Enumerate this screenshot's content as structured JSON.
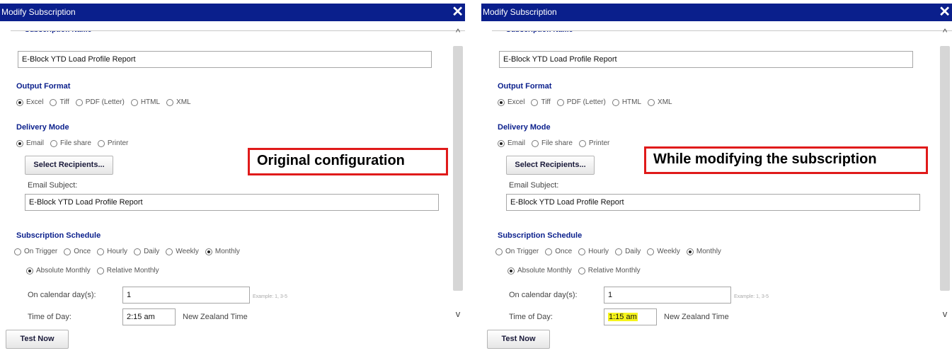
{
  "dialogs": [
    {
      "title": "Modify Subscription",
      "close_icon": "close-icon",
      "clipped_label": "Subscription Name",
      "subscription_name": "E-Block YTD Load Profile Report",
      "output_format": {
        "heading": "Output Format",
        "options": [
          "Excel",
          "Tiff",
          "PDF (Letter)",
          "HTML",
          "XML"
        ],
        "selected": "Excel"
      },
      "delivery_mode": {
        "heading": "Delivery Mode",
        "options": [
          "Email",
          "File share",
          "Printer"
        ],
        "selected": "Email",
        "select_recipients_label": "Select Recipients...",
        "email_subject_label": "Email Subject:",
        "email_subject": "E-Block YTD Load Profile Report"
      },
      "schedule": {
        "heading": "Subscription Schedule",
        "options": [
          "On Trigger",
          "Once",
          "Hourly",
          "Daily",
          "Weekly",
          "Monthly"
        ],
        "selected": "Monthly",
        "monthly_options": [
          "Absolute Monthly",
          "Relative Monthly"
        ],
        "monthly_selected": "Absolute Monthly",
        "calendar_days_label": "On calendar day(s):",
        "calendar_days": "1",
        "calendar_example": "Example: 1, 3-5",
        "time_label": "Time of Day:",
        "time_value": "2:15 am",
        "time_highlighted": false,
        "timezone": "New Zealand Time"
      },
      "test_now_label": "Test Now",
      "callout": "Original configuration"
    },
    {
      "title": "Modify Subscription",
      "close_icon": "close-icon",
      "clipped_label": "Subscription Name",
      "subscription_name": "E-Block YTD Load Profile Report",
      "output_format": {
        "heading": "Output Format",
        "options": [
          "Excel",
          "Tiff",
          "PDF (Letter)",
          "HTML",
          "XML"
        ],
        "selected": "Excel"
      },
      "delivery_mode": {
        "heading": "Delivery Mode",
        "options": [
          "Email",
          "File share",
          "Printer"
        ],
        "selected": "Email",
        "select_recipients_label": "Select Recipients...",
        "email_subject_label": "Email Subject:",
        "email_subject": "E-Block YTD Load Profile Report"
      },
      "schedule": {
        "heading": "Subscription Schedule",
        "options": [
          "On Trigger",
          "Once",
          "Hourly",
          "Daily",
          "Weekly",
          "Monthly"
        ],
        "selected": "Monthly",
        "monthly_options": [
          "Absolute Monthly",
          "Relative Monthly"
        ],
        "monthly_selected": "Absolute Monthly",
        "calendar_days_label": "On calendar day(s):",
        "calendar_days": "1",
        "calendar_example": "Example: 1, 3-5",
        "time_label": "Time of Day:",
        "time_value": "1:15 am",
        "time_highlighted": true,
        "highlight_color": "#f6f41c",
        "timezone": "New Zealand Time"
      },
      "test_now_label": "Test Now",
      "callout": "While modifying the subscription"
    }
  ],
  "colors": {
    "titlebar": "#0a1f8c",
    "section_heading": "#0a1f8c",
    "callout_border": "#e01a1a"
  }
}
